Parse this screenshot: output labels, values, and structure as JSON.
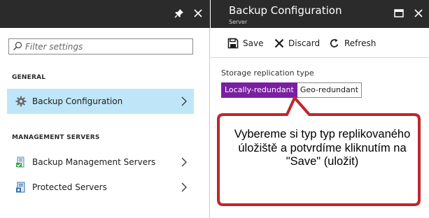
{
  "left_blade": {
    "filter_placeholder": "Filter settings",
    "sections": {
      "general": "GENERAL",
      "management": "MANAGEMENT SERVERS"
    },
    "items": [
      {
        "label": "Backup Configuration",
        "icon": "gear-icon",
        "selected": true
      },
      {
        "label": "Backup Management Servers",
        "icon": "server-icon",
        "selected": false
      },
      {
        "label": "Protected Servers",
        "icon": "protected-server-icon",
        "selected": false
      }
    ]
  },
  "right_blade": {
    "title": "Backup Configuration",
    "subtitle": "Server",
    "toolbar": {
      "save_label": "Save",
      "discard_label": "Discard",
      "refresh_label": "Refresh"
    },
    "storage_replication": {
      "label": "Storage replication type",
      "options": [
        "Locally-redundant",
        "Geo-redundant"
      ],
      "selected": "Locally-redundant"
    }
  },
  "callout": {
    "text": "Vybereme si typ typ replikovaného úložiště a potvrdíme kliknutím na \"Save\" (uložit)"
  },
  "colors": {
    "header_bg": "#2b2b2b",
    "selected_item_bg": "#bfe6f8",
    "selected_option_bg": "#7a1fa2",
    "callout_border": "#c0262d"
  }
}
